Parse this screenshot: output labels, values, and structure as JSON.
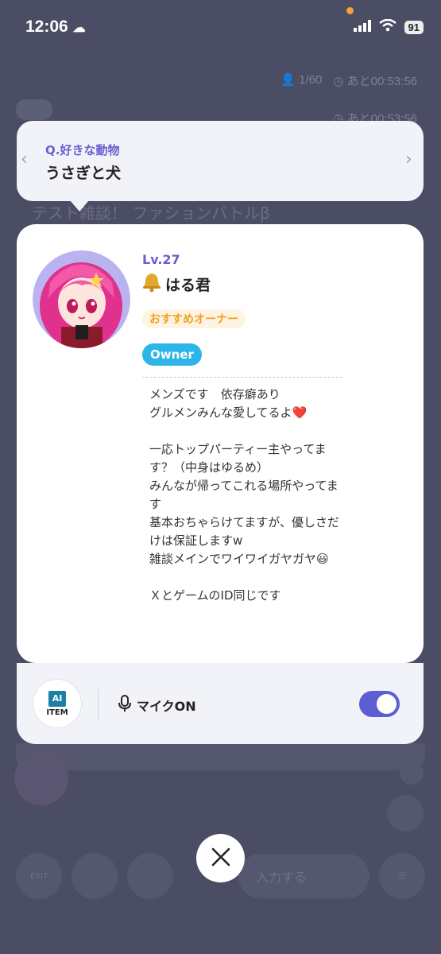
{
  "status_bar": {
    "time": "12:06",
    "battery": "91"
  },
  "background": {
    "participants": "1/60",
    "timer": "あと00:53:56",
    "timer_secondary": "あと00:53:56",
    "room_title": "テスト雑談！ ファションバトルβ",
    "input_placeholder": "入力する",
    "exit_label": "EXIT"
  },
  "question": {
    "label": "Q.好きな動物",
    "answer": "うさぎと犬"
  },
  "profile": {
    "level": "Lv.27",
    "name_icon": "bell-icon",
    "name": "はる君",
    "recommended_badge": "おすすめオーナー",
    "role_badge": "Owner",
    "bio": "メンズです　依存癖あり\nグルメンみんな愛してるよ❤️\n\n一応トップパーティー主やってます？（中身はゆるめ）\nみんなが帰ってこれる場所やってます\n基本おちゃらけてますが、優しさだけは保証しますw\n雑談メインでワイワイガヤガヤ😃\n\nＸとゲームのID同じです"
  },
  "controls": {
    "ai_icon_text": "AI",
    "ai_item_label": "ITEM",
    "mic_label": "マイクON",
    "mic_toggle_on": true,
    "accent_color": "#5b5fd2"
  },
  "close_icon": "close-icon"
}
